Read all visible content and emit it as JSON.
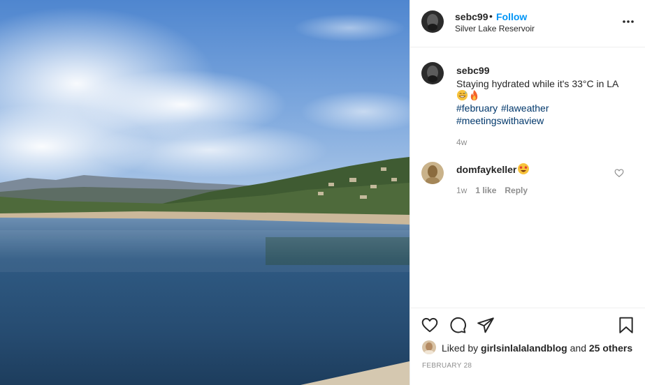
{
  "photo": {
    "alt_icon": "photo"
  },
  "header": {
    "username": "sebc99",
    "separator": "•",
    "follow_label": "Follow",
    "location": "Silver Lake Reservoir",
    "more_icon": "more-horizontal-icon"
  },
  "caption": {
    "username": "sebc99",
    "text": "Staying hydrated while it's 33°C in LA",
    "emojis": [
      "grinning-sweat-emoji",
      "fire-emoji"
    ],
    "hashtags": [
      "#february",
      "#laweather",
      "#meetingswithaview"
    ],
    "time": "4w"
  },
  "comment": {
    "username": "domfaykeller",
    "emoji": "star-struck-emoji",
    "time": "1w",
    "likes": "1 like",
    "reply_label": "Reply"
  },
  "actions": {
    "liked_prefix": "Liked by",
    "liked_user": "girlsinlalalandblog",
    "liked_and": "and",
    "liked_count": "25 others",
    "date": "FEBRUARY 28"
  },
  "colors": {
    "link_blue": "#0095f6",
    "hashtag": "#00376b",
    "muted": "#8e8e8e",
    "text": "#262626"
  }
}
